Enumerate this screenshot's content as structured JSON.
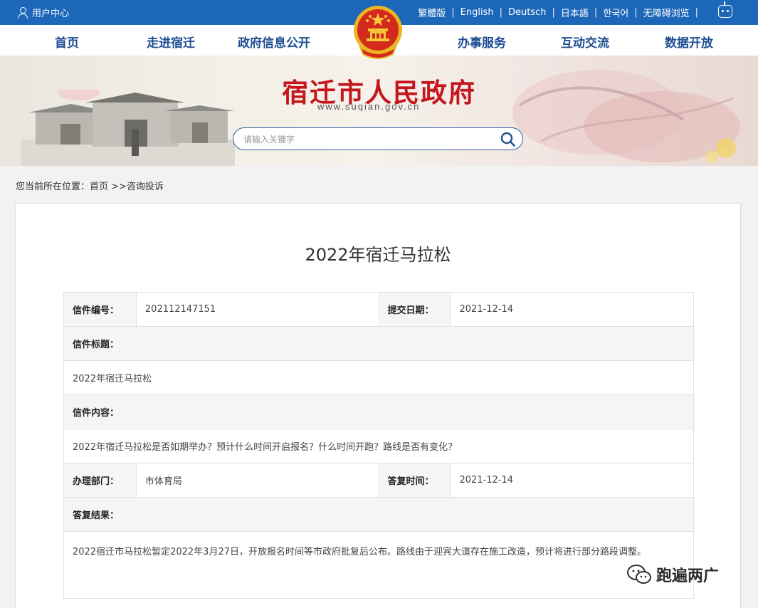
{
  "topbar": {
    "user_center": "用户中心",
    "languages": [
      "繁體版",
      "English",
      "Deutsch",
      "日本語",
      "한국어",
      "无障碍浏览"
    ],
    "separator": "|"
  },
  "nav": {
    "items": [
      "首页",
      "走进宿迁",
      "政府信息公开",
      "办事服务",
      "互动交流",
      "数据开放"
    ]
  },
  "banner": {
    "site_title": "宿迁市人民政府",
    "site_url": "www.suqian.gov.cn",
    "search_placeholder": "请输入关键字"
  },
  "breadcrumb": {
    "text": "您当前所在位置：首页 >>咨询投诉"
  },
  "letter": {
    "page_title": "2022年宿迁马拉松",
    "number_label": "信件编号：",
    "number_value": "202112147151",
    "submit_date_label": "提交日期：",
    "submit_date_value": "2021-12-14",
    "subject_label": "信件标题：",
    "subject_value": "2022年宿迁马拉松",
    "content_label": "信件内容：",
    "content_value": "2022年宿迁马拉松是否如期举办？预计什么时间开启报名？什么时间开跑？路线是否有变化？",
    "dept_label": "办理部门：",
    "dept_value": "市体育局",
    "reply_time_label": "答复时间：",
    "reply_time_value": "2021-12-14",
    "result_label": "答复结果：",
    "result_value": "2022宿迁市马拉松暂定2022年3月27日，开放报名时间等市政府批复后公布。路线由于迎宾大道存在施工改造，预计将进行部分路段调整。"
  },
  "watermark": {
    "text": "跑遍两广"
  },
  "colors": {
    "topbar": "#1d67b8",
    "nav_text": "#1d4d92",
    "title_red": "#c5161d"
  }
}
